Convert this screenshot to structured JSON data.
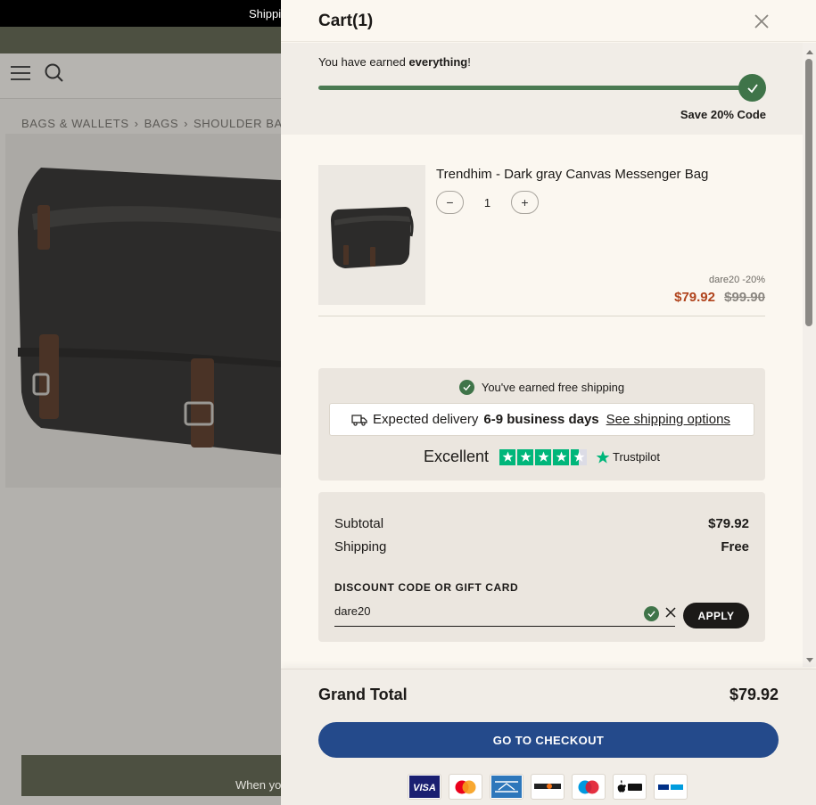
{
  "background": {
    "announcement": "Shippi",
    "breadcrumb": [
      "BAGS & WALLETS",
      "BAGS",
      "SHOULDER BA"
    ],
    "cta_text": "When you"
  },
  "cart": {
    "title": "Cart(1)",
    "progress": {
      "message_prefix": "You have earned ",
      "message_bold": "everything",
      "message_suffix": "!",
      "label": "Save 20% Code",
      "fill_fraction": 1.0
    },
    "item": {
      "name": "Trendhim - Dark gray Canvas Messenger Bag",
      "quantity": "1",
      "minus": "−",
      "plus": "+",
      "discount_note": "dare20 -20%",
      "price_new": "$79.92",
      "price_old": "$99.90"
    },
    "shipping": {
      "free_text": "You've earned free shipping",
      "delivery_prefix": "Expected delivery",
      "delivery_days": "6-9 business days",
      "delivery_link": "See shipping options"
    },
    "trustpilot": {
      "rating_word": "Excellent",
      "stars": 4.5,
      "brand": "Trustpilot"
    },
    "summary": {
      "subtotal_label": "Subtotal",
      "subtotal_value": "$79.92",
      "shipping_label": "Shipping",
      "shipping_value": "Free",
      "discount_label": "DISCOUNT CODE OR GIFT CARD",
      "discount_value": "dare20",
      "apply_label": "APPLY"
    },
    "footer": {
      "grand_total_label": "Grand Total",
      "grand_total_value": "$79.92",
      "checkout_label": "GO TO CHECKOUT",
      "payments": [
        "VISA",
        "Mastercard",
        "American Express",
        "Discover",
        "Maestro",
        "Apple Pay",
        "PayPal"
      ]
    }
  },
  "colors": {
    "accent_green": "#3f7449",
    "checkout_blue": "#244a8b",
    "sale_red": "#b0431c",
    "trustpilot_green": "#00b67a"
  }
}
